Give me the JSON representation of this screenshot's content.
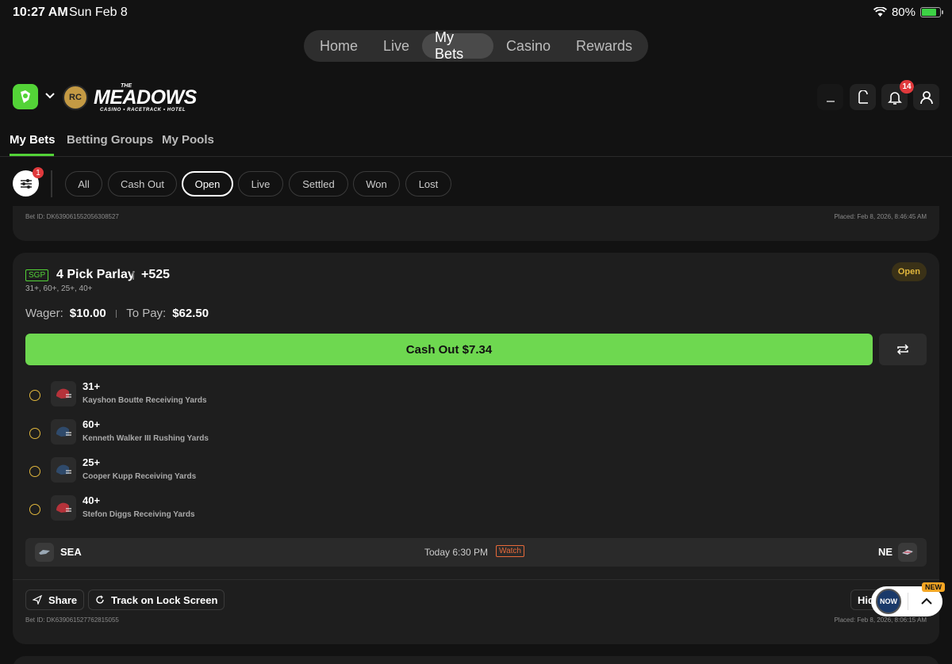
{
  "status_bar": {
    "time": "10:27 AM",
    "date": "Sun Feb 8",
    "battery": "80%",
    "battery_level": 0.8
  },
  "top_nav": {
    "items": [
      "Home",
      "Live",
      "My Bets",
      "Casino",
      "Rewards"
    ],
    "active": "My Bets"
  },
  "header": {
    "casino_badge": "RC",
    "brand_title": "MEADOWS",
    "brand_prefix": "THE",
    "brand_sub": "CASINO • RACETRACK • HOTEL",
    "notifications_count": "14"
  },
  "sub_tabs": {
    "items": [
      "My Bets",
      "Betting Groups",
      "My Pools"
    ],
    "active": "My Bets"
  },
  "filters": {
    "count": "1",
    "chips": [
      "All",
      "Cash Out",
      "Open",
      "Live",
      "Settled",
      "Won",
      "Lost"
    ],
    "active": "Open"
  },
  "prev_card": {
    "bet_id": "Bet ID: DK639061552056308527",
    "placed": "Placed: Feb 8, 2026, 8:46:45 AM"
  },
  "bet": {
    "badge": "SGP",
    "title": "4 Pick Parlay",
    "odds": "+525",
    "picks_summary": "31+, 60+, 25+, 40+",
    "status": "Open",
    "wager_label": "Wager:",
    "wager": "$10.00",
    "to_pay_label": "To Pay:",
    "to_pay": "$62.50",
    "cash_out": "Cash Out $7.34",
    "legs": [
      {
        "line": "31+",
        "desc": "Kayshon Boutte Receiving Yards",
        "team": "NE"
      },
      {
        "line": "60+",
        "desc": "Kenneth Walker III Rushing Yards",
        "team": "SEA"
      },
      {
        "line": "25+",
        "desc": "Cooper Kupp Receiving Yards",
        "team": "SEA"
      },
      {
        "line": "40+",
        "desc": "Stefon Diggs Receiving Yards",
        "team": "NE"
      }
    ],
    "game": {
      "away": "SEA",
      "home": "NE",
      "time": "Today 6:30 PM",
      "watch": "Watch"
    },
    "share": "Share",
    "track": "Track on Lock Screen",
    "hide": "Hid",
    "bet_id": "Bet ID: DK639061527762815055",
    "placed": "Placed: Feb 8, 2026, 8:06:15 AM"
  },
  "widget": {
    "new_label": "NEW",
    "now_label": "NOW"
  },
  "colors": {
    "accent": "#53d337",
    "cashout": "#6ed850",
    "open": "#e0b63c",
    "watch": "#e86a3a",
    "badge_red": "#e0393c"
  }
}
